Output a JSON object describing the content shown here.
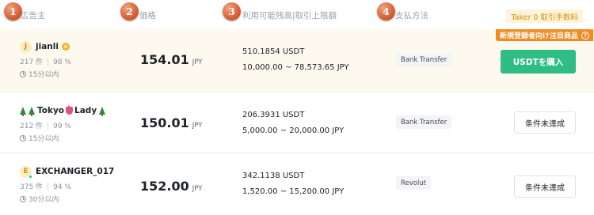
{
  "header": {
    "advertiser": "広告主",
    "price": "価格",
    "available_limit": "利用可能残高|取引上限額",
    "payment": "支払方法",
    "fee_badge": "Taker 0 取引手数料",
    "steps": [
      "1",
      "2",
      "3",
      "4"
    ]
  },
  "rows": [
    {
      "avatar_letter": "J",
      "name": "jianli",
      "orders": "217 件",
      "completion": "98 %",
      "time": "15分以内",
      "price": "154.01",
      "currency": "JPY",
      "available": "510.1854 USDT",
      "limit": "10,000.00 ~ 78,573.65 JPY",
      "payment": "Bank Transfer",
      "action": "USDTを購入",
      "promo": "新規登録者向け注目商品",
      "promo_help": "?"
    },
    {
      "name_prefix": "",
      "name_mid": "Tokyo",
      "name_end": "Lady",
      "orders": "212 件",
      "completion": "99 %",
      "time": "15分以内",
      "price": "150.01",
      "currency": "JPY",
      "available": "206.3931 USDT",
      "limit": "5,000.00 ~ 20,000.00 JPY",
      "payment": "Bank Transfer",
      "action": "条件未達成"
    },
    {
      "avatar_letter": "E",
      "name": "EXCHANGER_017",
      "orders": "375 件",
      "completion": "94 %",
      "time": "30分以内",
      "price": "152.00",
      "currency": "JPY",
      "available": "342.1138 USDT",
      "limit": "1,520.00 ~ 15,200.00 JPY",
      "payment": "Revolut",
      "action": "条件未達成"
    }
  ],
  "colors": {
    "buy": "#2ebd85",
    "promo": "#f08b22",
    "fee": "#e08e00",
    "highlight_row": "#fef9ee"
  },
  "icons": [
    "medal-icon",
    "clock-icon",
    "tree-emoji-icon",
    "tulip-emoji-icon",
    "help-icon",
    "online-status-icon"
  ]
}
